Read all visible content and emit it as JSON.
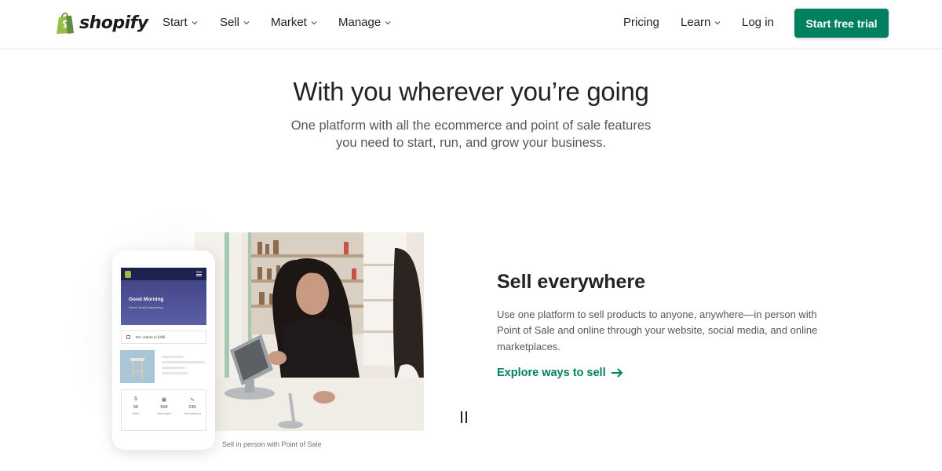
{
  "nav": {
    "logo_text": "shopify",
    "items": [
      {
        "label": "Start"
      },
      {
        "label": "Sell"
      },
      {
        "label": "Market"
      },
      {
        "label": "Manage"
      }
    ],
    "pricing": "Pricing",
    "learn": "Learn",
    "login": "Log in",
    "cta": "Start free trial"
  },
  "hero": {
    "title": "With you wherever you’re going",
    "subtitle_line1": "One platform with all the ecommerce and point of sale features",
    "subtitle_line2": "you need to start, run, and grow your business."
  },
  "feature": {
    "title": "Sell everywhere",
    "body": "Use one platform to sell products to anyone, anywhere—in person with Point of Sale and online through your website, social media, and online marketplaces.",
    "link": "Explore ways to sell",
    "caption": "Sell in person with Point of Sale"
  },
  "phone": {
    "greeting": "Good Morning",
    "greeting_sub": "Here's what's happening",
    "orders_text": "50+ orders to fulfill",
    "stats": [
      {
        "value": "50",
        "label": "Sales",
        "icon": "dollar-icon"
      },
      {
        "value": "504",
        "label": "Total orders",
        "icon": "orders-icon"
      },
      {
        "value": "230",
        "label": "Total sessions",
        "icon": "trend-icon"
      }
    ]
  },
  "colors": {
    "brand_green": "#008060",
    "logo_green": "#95bf47",
    "text": "#212326",
    "muted": "#54585d"
  }
}
